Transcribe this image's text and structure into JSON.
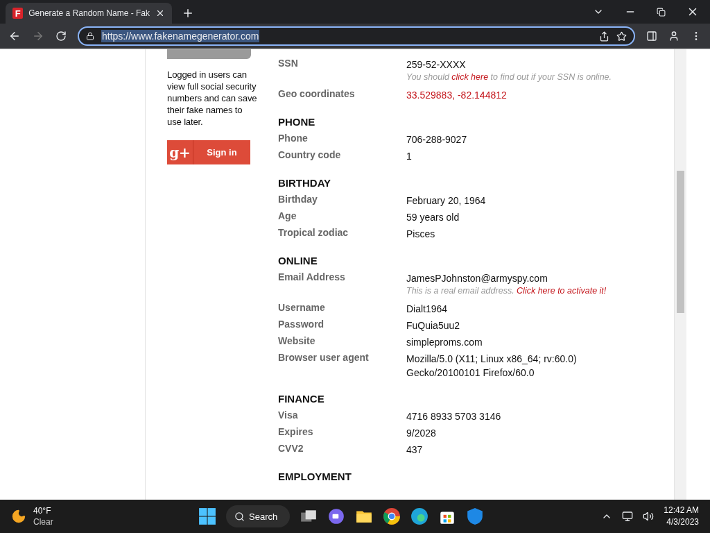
{
  "browser": {
    "tab": {
      "favicon": "F",
      "title": "Generate a Random Name - Fak",
      "selected": true
    },
    "address": "https://www.fakenamegenerator.com"
  },
  "sidebar": {
    "message": "Logged in users can view full social security numbers and can save their fake names to use later.",
    "signin": {
      "icon": "g+",
      "label": "Sign in"
    }
  },
  "sections": [
    {
      "rows": [
        {
          "label": "SSN",
          "kind": "plain",
          "lines": [
            "259-52-XXXX"
          ],
          "note": {
            "before": "You should ",
            "link": "click here",
            "after": " to find out if your SSN is online."
          }
        },
        {
          "label": "Geo coordinates",
          "kind": "link",
          "lines": [
            "33.529883, -82.144812"
          ]
        }
      ]
    },
    {
      "heading": "PHONE",
      "rows": [
        {
          "label": "Phone",
          "kind": "plain",
          "lines": [
            "706-288-9027"
          ]
        },
        {
          "label": "Country code",
          "kind": "plain",
          "lines": [
            "1"
          ]
        }
      ]
    },
    {
      "heading": "BIRTHDAY",
      "rows": [
        {
          "label": "Birthday",
          "kind": "plain",
          "lines": [
            "February 20, 1964"
          ]
        },
        {
          "label": "Age",
          "kind": "plain",
          "lines": [
            "59 years old"
          ]
        },
        {
          "label": "Tropical zodiac",
          "kind": "plain",
          "lines": [
            "Pisces"
          ]
        }
      ]
    },
    {
      "heading": "ONLINE",
      "rows": [
        {
          "label": "Email Address",
          "kind": "plain",
          "lines": [
            "JamesPJohnston@armyspy.com"
          ],
          "note": {
            "before": "This is a real email address. ",
            "link": "Click here to activate it!"
          }
        },
        {
          "label": "Username",
          "kind": "plain",
          "lines": [
            "Dialt1964"
          ]
        },
        {
          "label": "Password",
          "kind": "plain",
          "lines": [
            "FuQuia5uu2"
          ]
        },
        {
          "label": "Website",
          "kind": "plain",
          "lines": [
            "simpleproms.com"
          ]
        },
        {
          "label": "Browser user agent",
          "kind": "plain",
          "lines": [
            "Mozilla/5.0 (X11; Linux x86_64; rv:60.0)",
            "Gecko/20100101 Firefox/60.0"
          ]
        }
      ]
    },
    {
      "heading": "FINANCE",
      "rows": [
        {
          "label": "Visa",
          "kind": "plain",
          "lines": [
            "4716 8933 5703 3146"
          ]
        },
        {
          "label": "Expires",
          "kind": "plain",
          "lines": [
            "9/2028"
          ]
        },
        {
          "label": "CVV2",
          "kind": "plain",
          "lines": [
            "437"
          ]
        }
      ]
    },
    {
      "heading": "EMPLOYMENT"
    }
  ],
  "taskbar": {
    "weather": {
      "temp": "40°F",
      "condition": "Clear"
    },
    "search": "Search",
    "time": "12:42 AM",
    "date": "4/3/2023"
  }
}
